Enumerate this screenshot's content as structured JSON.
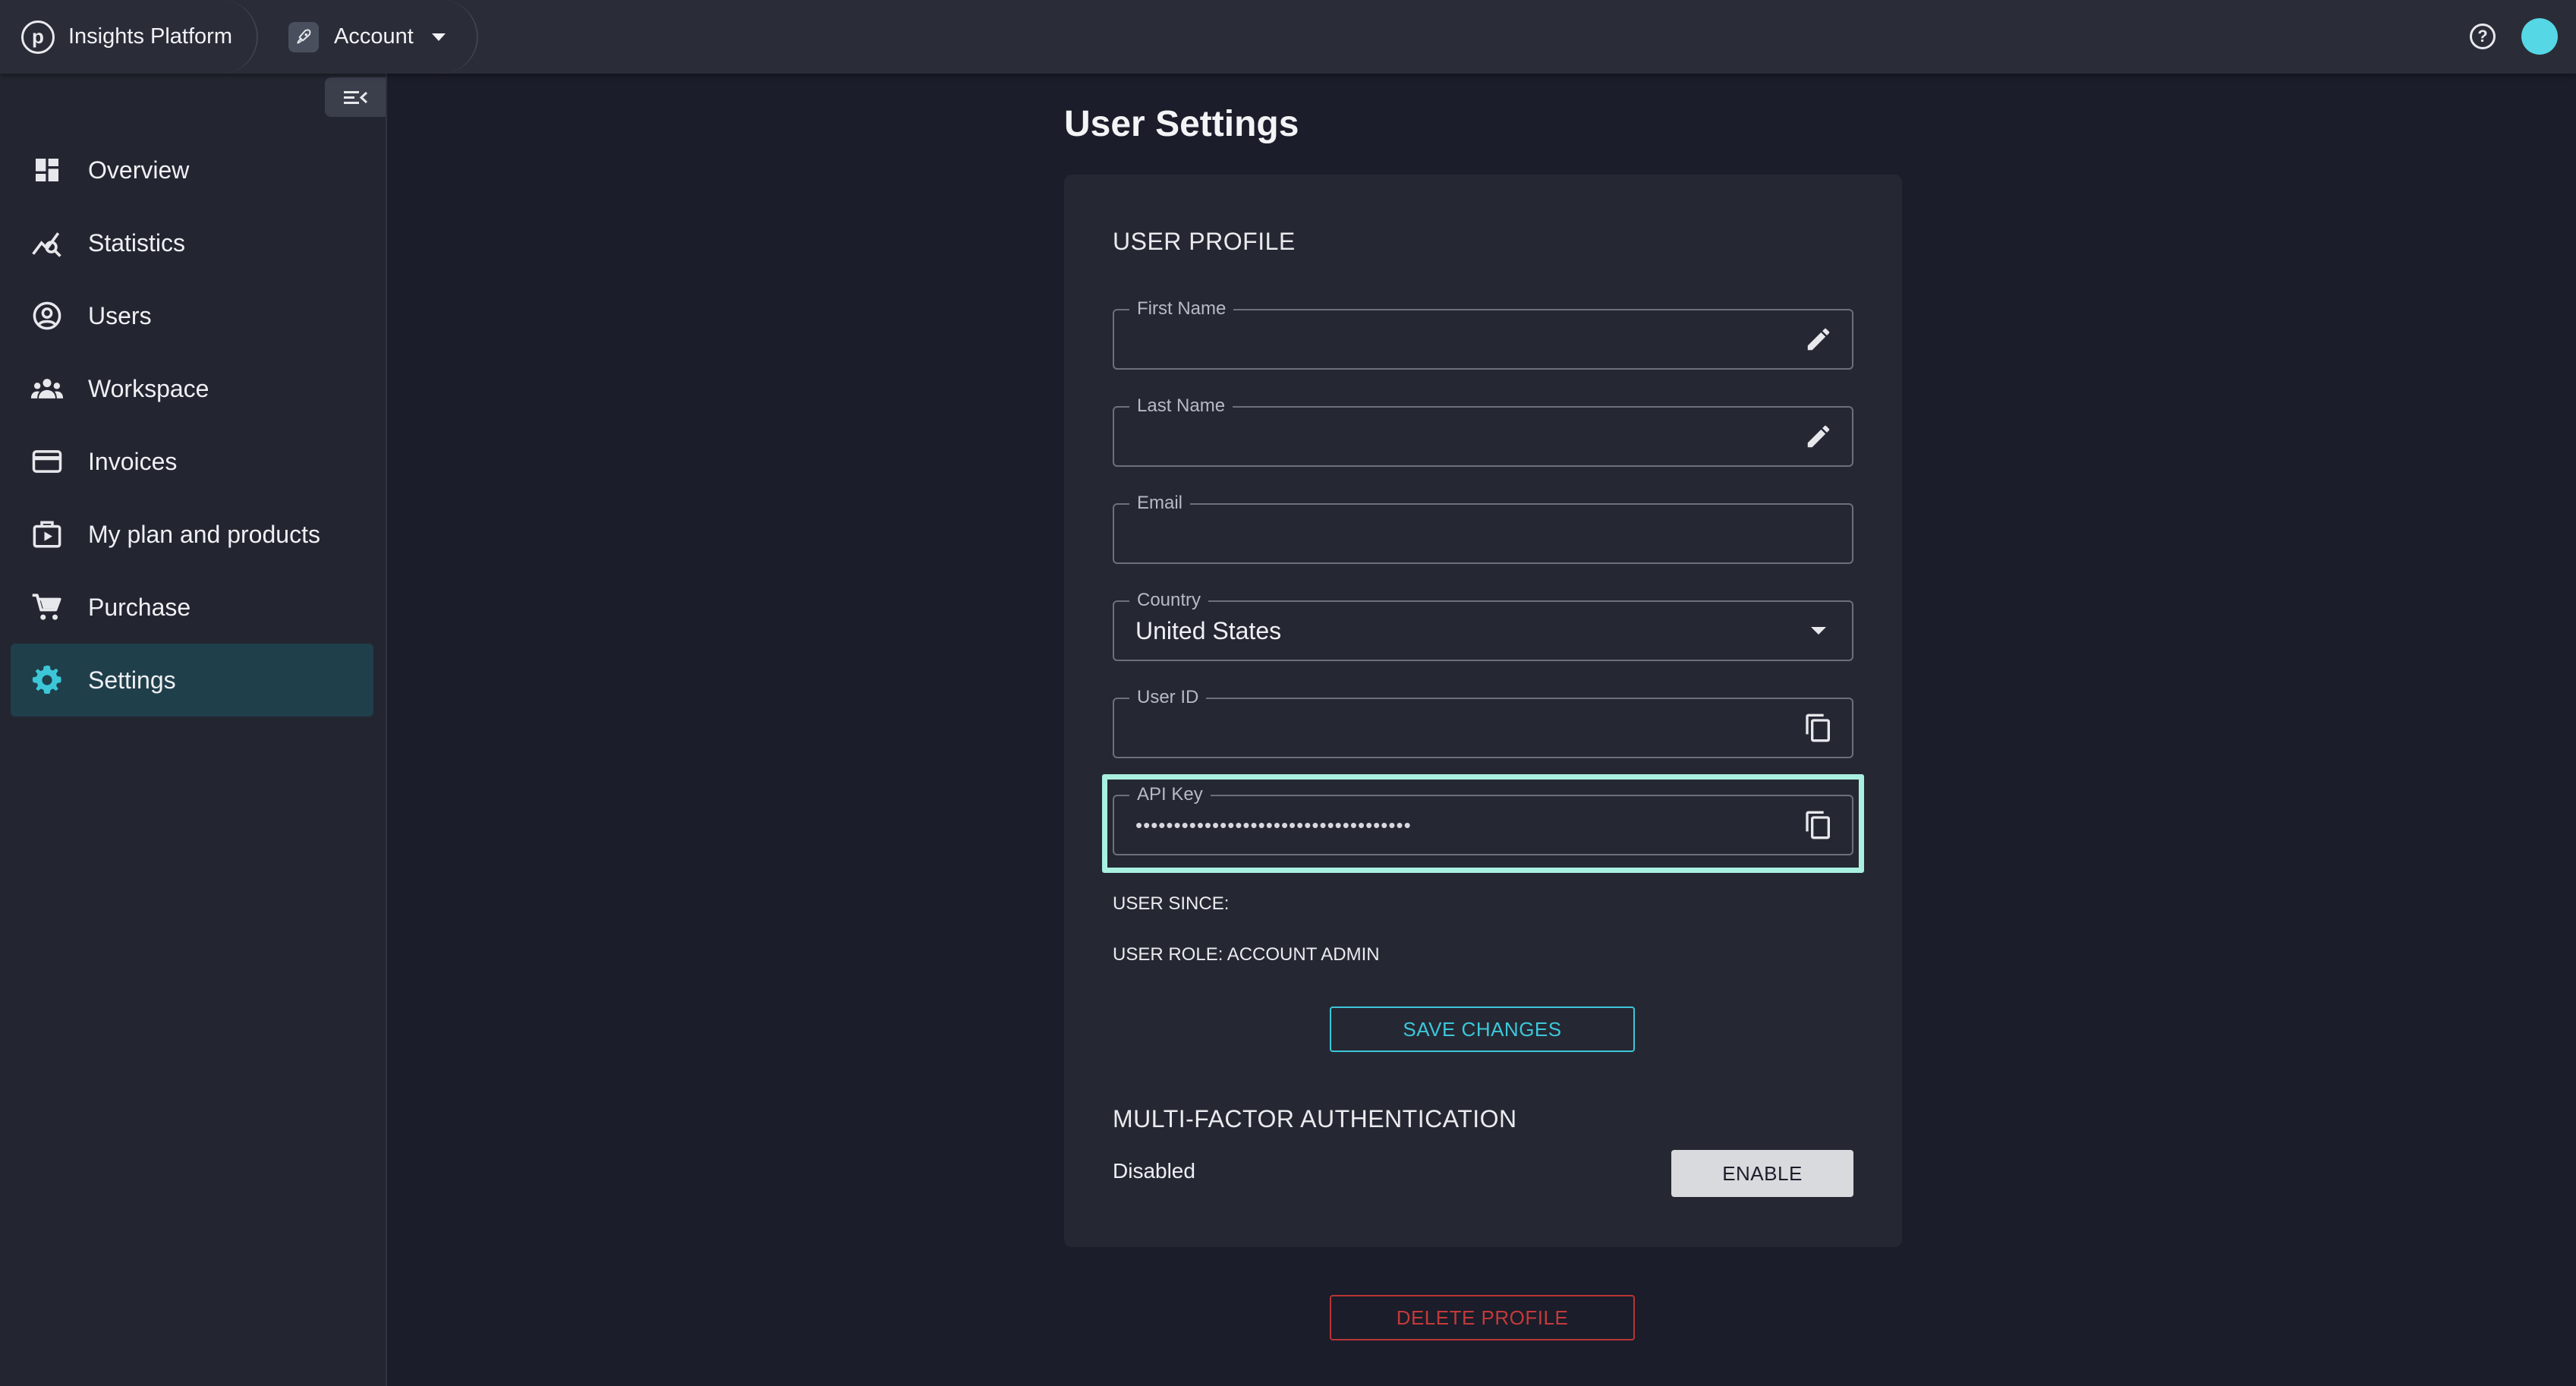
{
  "topbar": {
    "brand_name": "Insights Platform",
    "brand_logo_letter": "p",
    "account_label": "Account",
    "help_glyph": "?"
  },
  "sidebar": {
    "items": [
      {
        "label": "Overview",
        "icon": "dashboard-icon"
      },
      {
        "label": "Statistics",
        "icon": "statistics-icon"
      },
      {
        "label": "Users",
        "icon": "user-circle-icon"
      },
      {
        "label": "Workspace",
        "icon": "group-icon"
      },
      {
        "label": "Invoices",
        "icon": "credit-card-icon"
      },
      {
        "label": "My plan and products",
        "icon": "plan-icon"
      },
      {
        "label": "Purchase",
        "icon": "cart-icon"
      },
      {
        "label": "Settings",
        "icon": "gear-icon",
        "active": true
      }
    ]
  },
  "main": {
    "page_title": "User Settings",
    "profile": {
      "section_title": "USER PROFILE",
      "first_name": {
        "label": "First Name",
        "value": ""
      },
      "last_name": {
        "label": "Last Name",
        "value": ""
      },
      "email": {
        "label": "Email",
        "value": ""
      },
      "country": {
        "label": "Country",
        "value": "United States"
      },
      "user_id": {
        "label": "User ID",
        "value": ""
      },
      "api_key": {
        "label": "API Key",
        "value": "••••••••••••••••••••••••••••••••••••"
      },
      "user_since": "USER SINCE:",
      "user_role": "USER ROLE: ACCOUNT ADMIN",
      "save_label": "SAVE CHANGES"
    },
    "mfa": {
      "section_title": "MULTI-FACTOR AUTHENTICATION",
      "status": "Disabled",
      "enable_label": "ENABLE"
    },
    "delete_label": "DELETE PROFILE"
  },
  "colors": {
    "accent": "#3cc7d9",
    "highlight": "#a9f0e0",
    "danger": "#c43a3a",
    "active_nav": "#1f3f4b"
  }
}
